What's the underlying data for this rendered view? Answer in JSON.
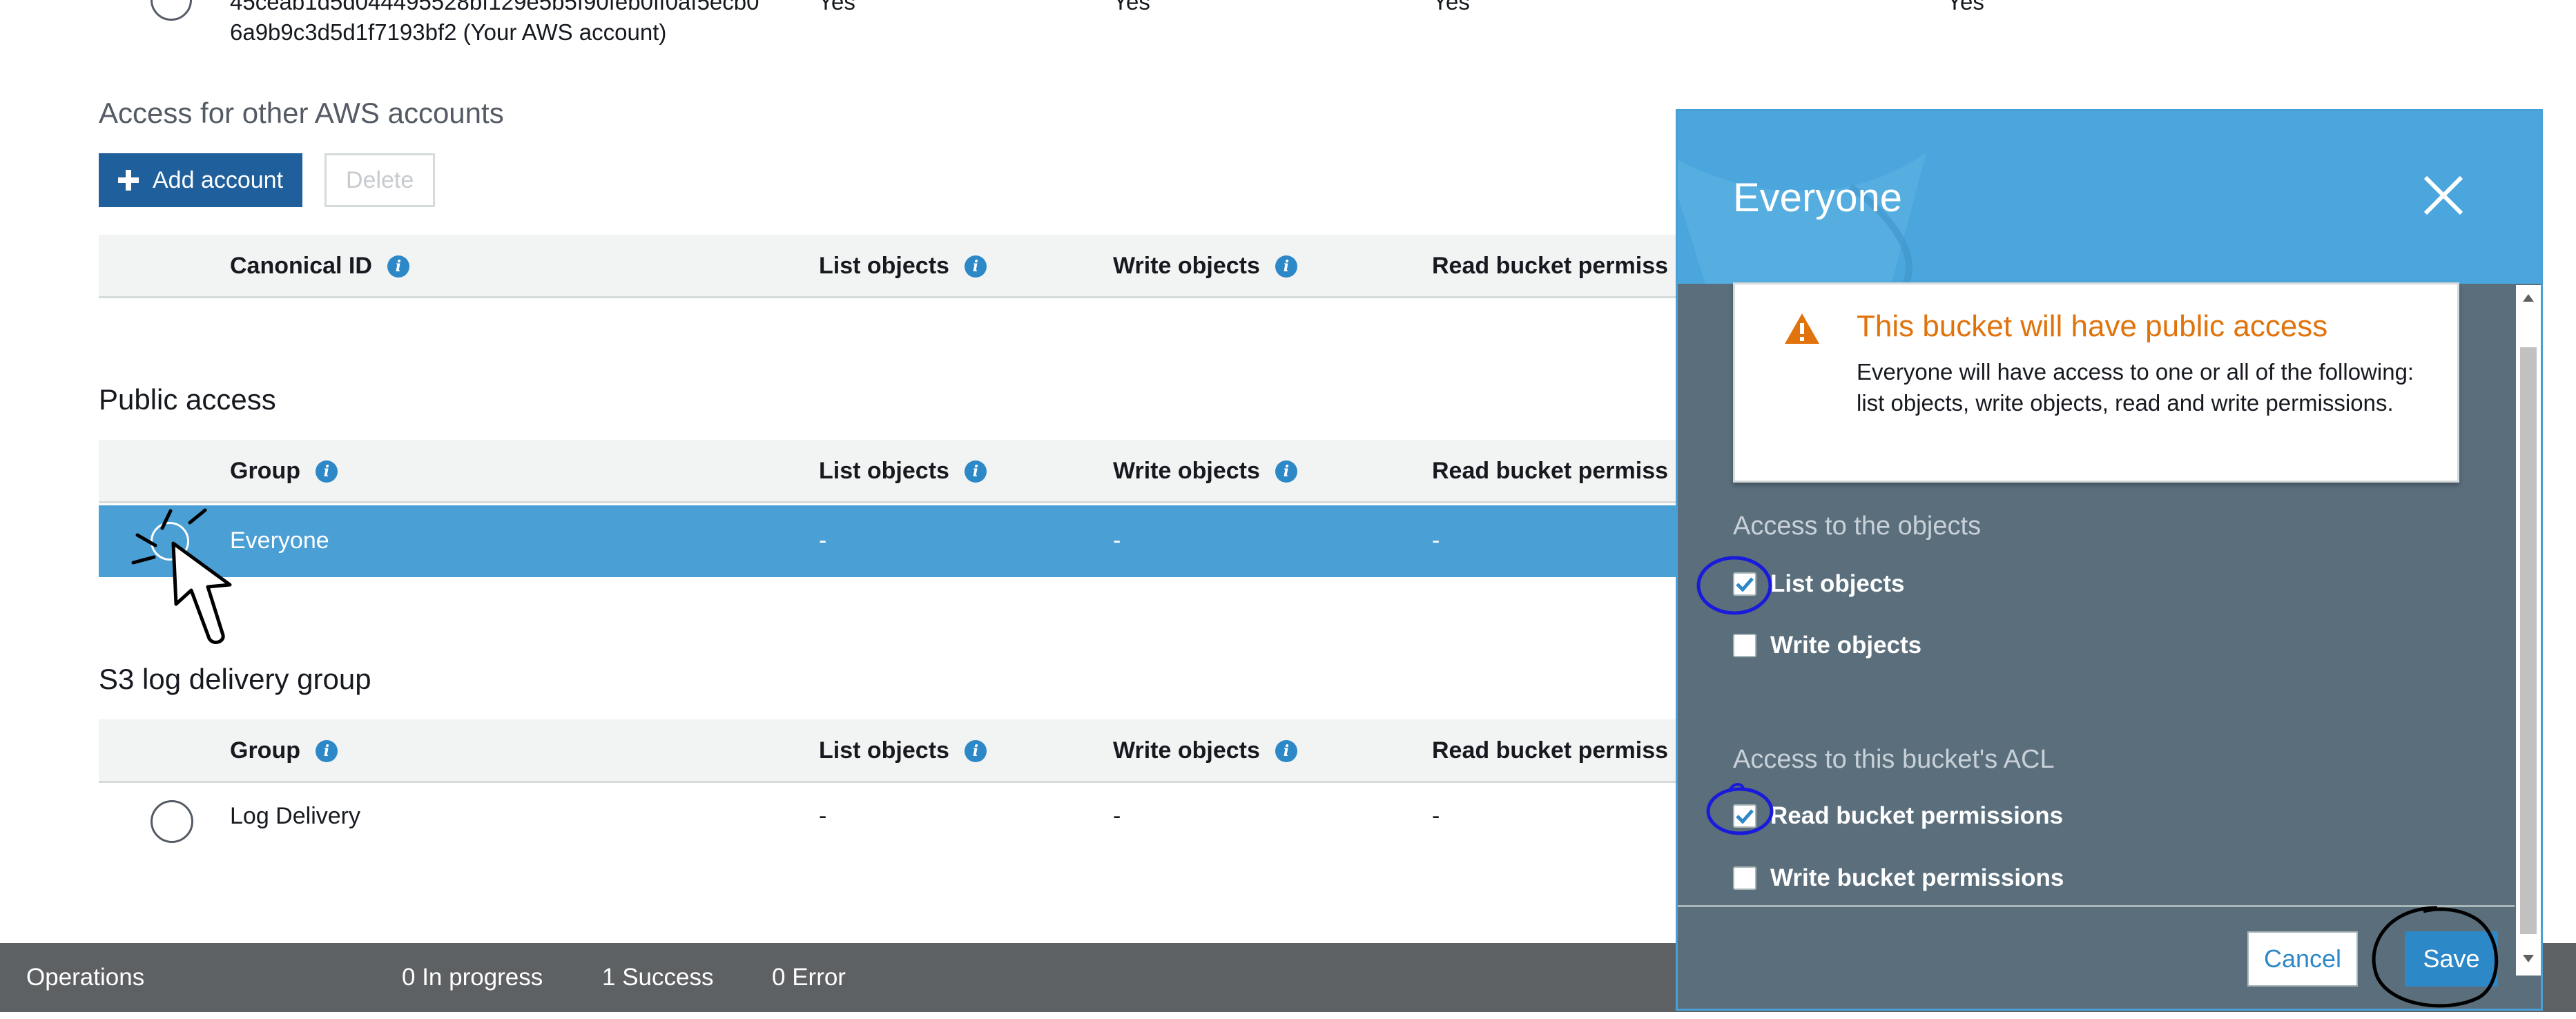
{
  "top_row": {
    "id_line1": "45ceab1d5d044495528bf129e5b5f90feb0ff0af5ecb0",
    "id_line2": "6a9b9c3d5d1f7193bf2 (Your AWS account)",
    "yes1": "Yes",
    "yes2": "Yes",
    "yes3": "Yes",
    "yes4": "Yes"
  },
  "other_accounts": {
    "title": "Access for other AWS accounts",
    "add_label": "Add account",
    "delete_label": "Delete",
    "headers": [
      "Canonical ID",
      "List objects",
      "Write objects",
      "Read bucket permiss"
    ]
  },
  "public_access": {
    "title": "Public access",
    "headers": [
      "Group",
      "List objects",
      "Write objects",
      "Read bucket permiss"
    ],
    "row": {
      "name": "Everyone",
      "list": "-",
      "write": "-",
      "read": "-"
    }
  },
  "log_delivery": {
    "title": "S3 log delivery group",
    "headers": [
      "Group",
      "List objects",
      "Write objects",
      "Read bucket permiss"
    ],
    "row": {
      "name": "Log Delivery",
      "list": "-",
      "write": "-",
      "read": "-"
    }
  },
  "statusbar": {
    "operations": "Operations",
    "in_progress": "0 In progress",
    "success": "1 Success",
    "error": "0 Error"
  },
  "modal": {
    "title": "Everyone",
    "warning_title": "This bucket will have public access",
    "warning_body": "Everyone will have access to one or all of the following: list objects, write objects, read and write permissions.",
    "objects_heading": "Access to the objects",
    "list_objects": "List objects",
    "write_objects": "Write objects",
    "acl_heading": "Access to this bucket's ACL",
    "read_bucket": "Read bucket permissions",
    "write_bucket": "Write bucket permissions",
    "cancel_label": "Cancel",
    "save_label": "Save",
    "checked": {
      "list_objects": true,
      "write_objects": false,
      "read_bucket": true,
      "write_bucket": false
    }
  },
  "colors": {
    "accent": "#4a9fd5",
    "primary_button": "#1f5f9c",
    "warning": "#e0730c",
    "statusbar": "#5e6163",
    "modal_body": "#5a6e7c"
  },
  "icons": [
    "plus-icon",
    "info-icon",
    "close-icon",
    "warning-icon",
    "check-icon",
    "cursor-icon",
    "scroll-up-icon",
    "scroll-down-icon"
  ]
}
